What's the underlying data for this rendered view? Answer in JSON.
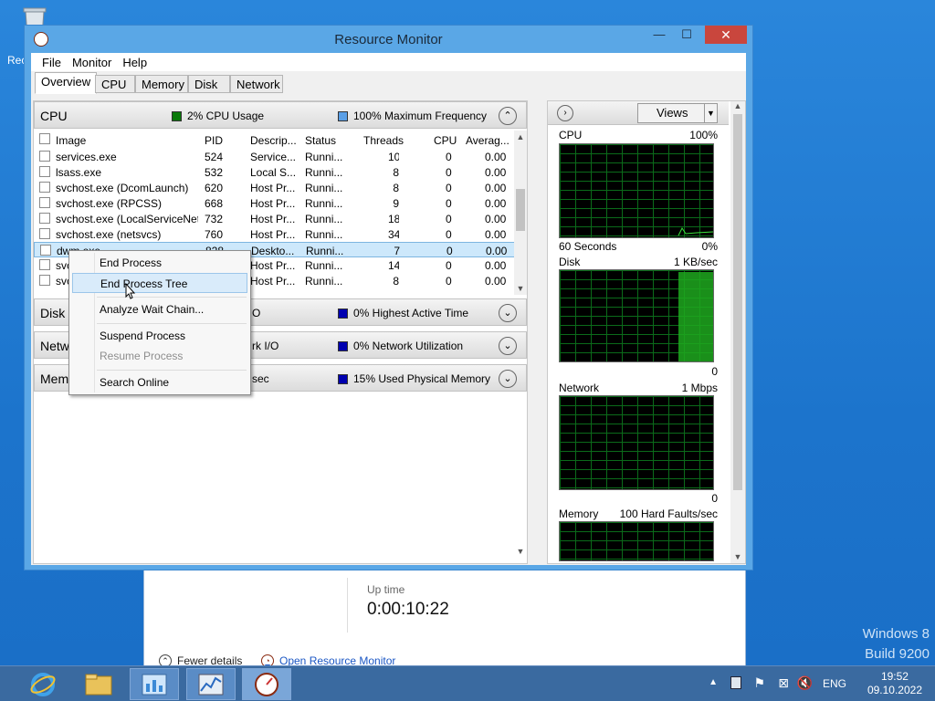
{
  "desktop": {
    "recycle_label": "Rec",
    "windows_version": "Windows 8",
    "build": "Build 9200"
  },
  "taskmanager": {
    "uptime_label": "Up time",
    "uptime_value": "0:00:10:22",
    "fewer_details": "Fewer details",
    "open_resource_monitor": "Open Resource Monitor"
  },
  "window": {
    "title": "Resource Monitor",
    "min": "—",
    "max": "☐",
    "close": "✕"
  },
  "menu": [
    "File",
    "Monitor",
    "Help"
  ],
  "tabs": [
    "Overview",
    "CPU",
    "Memory",
    "Disk",
    "Network"
  ],
  "cpu_section": {
    "name": "CPU",
    "usage": "2% CPU Usage",
    "freq": "100% Maximum Frequency",
    "usage_color": "#0a7a0a",
    "freq_color": "#5a9fe6",
    "columns": [
      "Image",
      "PID",
      "Descrip...",
      "Status",
      "Threads",
      "CPU",
      "Averag..."
    ],
    "rows": [
      {
        "image": "services.exe",
        "pid": "524",
        "desc": "Service...",
        "status": "Runni...",
        "threads": "10",
        "cpu": "0",
        "avg": "0.00"
      },
      {
        "image": "lsass.exe",
        "pid": "532",
        "desc": "Local S...",
        "status": "Runni...",
        "threads": "8",
        "cpu": "0",
        "avg": "0.00"
      },
      {
        "image": "svchost.exe (DcomLaunch)",
        "pid": "620",
        "desc": "Host Pr...",
        "status": "Runni...",
        "threads": "8",
        "cpu": "0",
        "avg": "0.00"
      },
      {
        "image": "svchost.exe (RPCSS)",
        "pid": "668",
        "desc": "Host Pr...",
        "status": "Runni...",
        "threads": "9",
        "cpu": "0",
        "avg": "0.00"
      },
      {
        "image": "svchost.exe (LocalServiceNet...",
        "pid": "732",
        "desc": "Host Pr...",
        "status": "Runni...",
        "threads": "18",
        "cpu": "0",
        "avg": "0.00"
      },
      {
        "image": "svchost.exe (netsvcs)",
        "pid": "760",
        "desc": "Host Pr...",
        "status": "Runni...",
        "threads": "34",
        "cpu": "0",
        "avg": "0.00"
      },
      {
        "image": "dwm.exe",
        "pid": "828",
        "desc": "Deskto...",
        "status": "Runni...",
        "threads": "7",
        "cpu": "0",
        "avg": "0.00"
      },
      {
        "image": "svc",
        "pid": "",
        "desc": "Host Pr...",
        "status": "Runni...",
        "threads": "14",
        "cpu": "0",
        "avg": "0.00"
      },
      {
        "image": "svc",
        "pid": "",
        "desc": "Host Pr...",
        "status": "Runni...",
        "threads": "8",
        "cpu": "0",
        "avg": "0.00"
      }
    ]
  },
  "disk_section": {
    "name": "Disk",
    "partial": "O",
    "indicator": "0% Highest Active Time",
    "color": "#0000b0"
  },
  "network_section": {
    "name": "Netwo",
    "partial": "rk I/O",
    "indicator": "0% Network Utilization",
    "color": "#0000b0"
  },
  "memory_section": {
    "name": "Memo",
    "partial": "sec",
    "indicator": "15% Used Physical Memory",
    "color": "#0000b0"
  },
  "right_panel": {
    "views": "Views",
    "graphs": [
      {
        "label": "CPU",
        "top_value": "100%",
        "bottom_left": "60 Seconds",
        "bottom_right": "0%"
      },
      {
        "label": "Disk",
        "top_value": "1 KB/sec",
        "bottom_left": "",
        "bottom_right": "0"
      },
      {
        "label": "Network",
        "top_value": "1 Mbps",
        "bottom_left": "",
        "bottom_right": "0"
      },
      {
        "label": "Memory",
        "top_value": "100 Hard Faults/sec",
        "bottom_left": "",
        "bottom_right": ""
      }
    ]
  },
  "context_menu": {
    "items": [
      "End Process",
      "End Process Tree",
      "Analyze Wait Chain...",
      "Suspend Process",
      "Resume Process",
      "Search Online"
    ],
    "highlighted": "End Process Tree",
    "disabled": "Resume Process"
  },
  "tray": {
    "language": "ENG",
    "time": "19:52",
    "date": "09.10.2022"
  }
}
